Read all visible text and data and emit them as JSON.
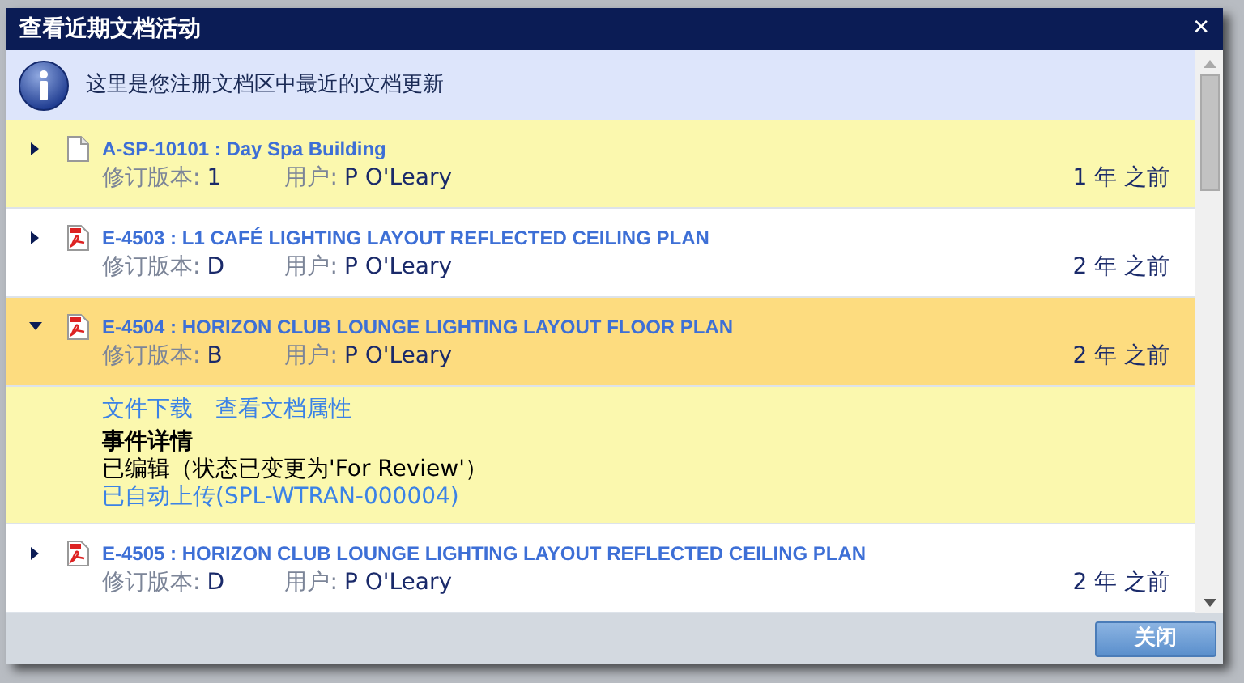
{
  "dialog": {
    "title": "查看近期文档活动",
    "close_glyph": "✕"
  },
  "info": {
    "text": "这里是您注册文档区中最近的文档更新"
  },
  "documents": [
    {
      "kind": "file",
      "title": "A-SP-10101 : Day Spa Building",
      "revision_label": "修订版本:",
      "revision": "1",
      "user_label": "用户:",
      "user": "P O'Leary",
      "age": "1 年 之前",
      "expanded": false,
      "selected": false,
      "highlighted": true
    },
    {
      "kind": "pdf",
      "title": "E-4503 : L1 CAFÉ LIGHTING LAYOUT REFLECTED CEILING PLAN",
      "revision_label": "修订版本:",
      "revision": "D",
      "user_label": "用户:",
      "user": "P O'Leary",
      "age": "2 年 之前",
      "expanded": false,
      "selected": false,
      "highlighted": false
    },
    {
      "kind": "pdf",
      "title": "E-4504 : HORIZON CLUB LOUNGE LIGHTING LAYOUT FLOOR PLAN",
      "revision_label": "修订版本:",
      "revision": "B",
      "user_label": "用户:",
      "user": "P O'Leary",
      "age": "2 年 之前",
      "expanded": true,
      "selected": true,
      "highlighted": false,
      "details": {
        "links": [
          "文件下载",
          "查看文档属性"
        ],
        "heading": "事件详情",
        "event": "已编辑（状态已变更为'For Review'）",
        "upload": "已自动上传(SPL-WTRAN-000004)"
      }
    },
    {
      "kind": "pdf",
      "title": "E-4505 : HORIZON CLUB LOUNGE LIGHTING LAYOUT REFLECTED CEILING PLAN",
      "revision_label": "修订版本:",
      "revision": "D",
      "user_label": "用户:",
      "user": "P O'Leary",
      "age": "2 年 之前",
      "expanded": false,
      "selected": false,
      "highlighted": false
    }
  ],
  "buttons": [
    "关闭"
  ]
}
